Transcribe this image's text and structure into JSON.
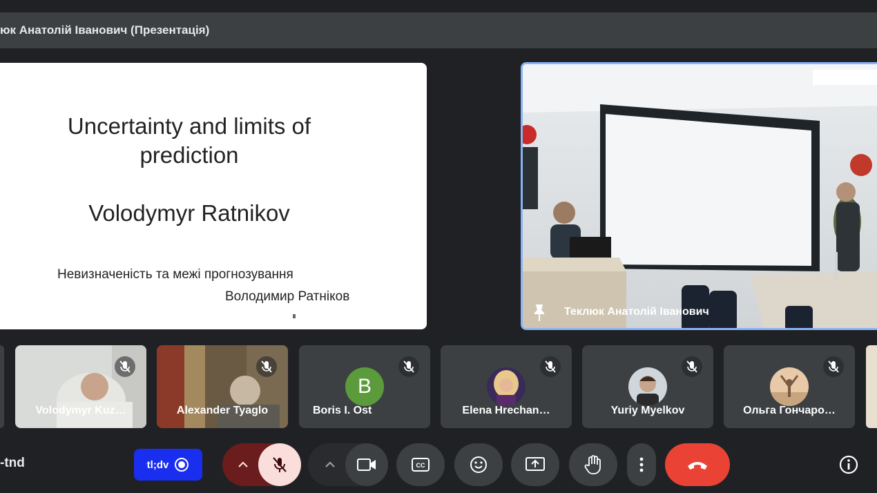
{
  "header": {
    "presenter_title": "юк Анатолій Іванович (Презентація)"
  },
  "slide": {
    "title_line1": "Uncertainty and limits of",
    "title_line2": "prediction",
    "author": "Volodymyr Ratnikov",
    "subtitle_ua": "Невизначеність та межі прогнозування",
    "author_ua": "Володимир Ратніков"
  },
  "speaker": {
    "name": "Теклюк Анатолій Іванович",
    "icon": "pin-icon"
  },
  "participants": [
    {
      "name": "Volodymyr Kuz…",
      "muted": true
    },
    {
      "name": "Alexander Tyaglo",
      "muted": true
    },
    {
      "name": "Boris I. Ost",
      "initial": "B",
      "avatar_color": "#5b9b3c",
      "muted": true
    },
    {
      "name": "Elena Hrechan…",
      "muted": true
    },
    {
      "name": "Yuriy Myelkov",
      "muted": true
    },
    {
      "name": "Ольга Гончаро…",
      "muted": true
    }
  ],
  "meeting": {
    "code": "-tnd",
    "caption_chip": "tl;dv"
  },
  "colors": {
    "background": "#202124",
    "tile": "#3c4043",
    "accent_blue": "#8ab4f8",
    "leave_red": "#ea4335",
    "mic_off_pink": "#f9dedc",
    "chip_blue": "#1a2ef0"
  },
  "controls": [
    "chevron-up-icon",
    "mic-off-icon",
    "chevron-up-icon",
    "camera-icon",
    "captions-icon",
    "emoji-icon",
    "present-icon",
    "raise-hand-icon",
    "more-vert-icon",
    "call-end-icon",
    "info-icon"
  ]
}
